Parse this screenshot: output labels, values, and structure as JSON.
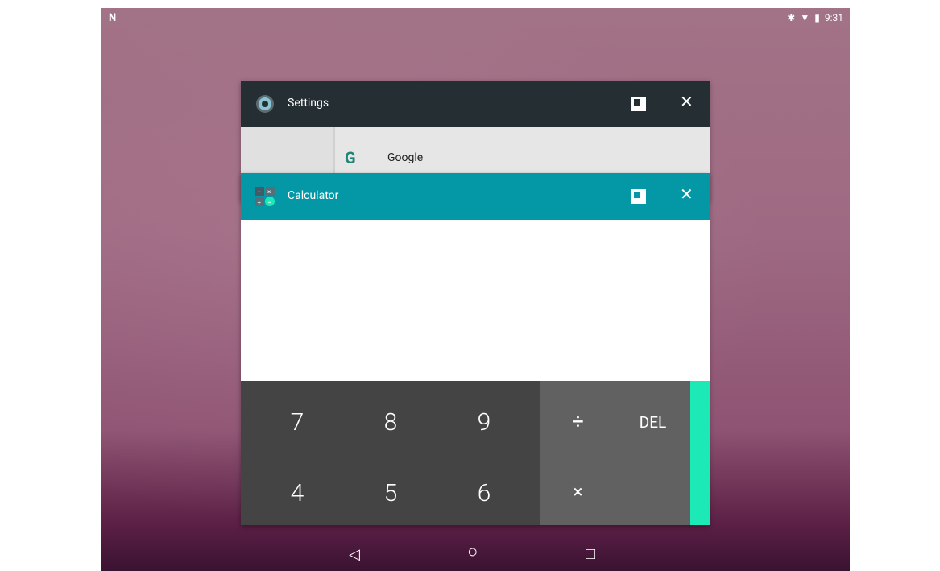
{
  "status_bar": {
    "notification_icon": "N",
    "bluetooth_icon": "bluetooth-icon",
    "wifi_icon": "wifi-icon",
    "battery_icon": "battery-icon",
    "time": "9:31"
  },
  "recents": {
    "settings_card": {
      "title": "Settings",
      "icon": "settings-gear-icon",
      "list_item_label": "Google",
      "list_item_icon": "google-g-icon"
    },
    "calculator_card": {
      "title": "Calculator",
      "icon": "calculator-icon",
      "keys_row1": [
        "7",
        "8",
        "9"
      ],
      "keys_row2": [
        "4",
        "5",
        "6"
      ],
      "op_divide": "÷",
      "op_delete": "DEL",
      "op_multiply": "×"
    }
  },
  "navigation": {
    "back": "◁",
    "home": "○",
    "recents": "□"
  },
  "colors": {
    "settings_header": "#242e33",
    "calculator_header": "#0497a6",
    "keypad_dark": "#444444",
    "keypad_ops": "#616161",
    "accent_drawer": "#1de9b6"
  }
}
